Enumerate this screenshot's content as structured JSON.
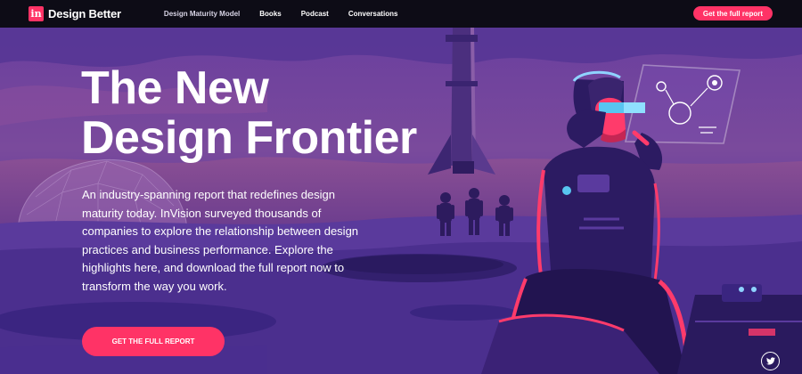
{
  "nav": {
    "logo_mark": "in",
    "logo_text": "Design Better",
    "links": [
      "Design Maturity Model",
      "Books",
      "Podcast",
      "Conversations"
    ],
    "cta_label": "Get the full report"
  },
  "hero": {
    "title_line1": "The New",
    "title_line2": "Design Frontier",
    "body": "An industry-spanning report that redefines design maturity today. InVision surveyed thousands of companies to explore the relationship between design practices and business performance. Explore the highlights here, and download the full report now to transform the way you work.",
    "cta_label": "GET THE FULL REPORT"
  },
  "social": {
    "icon": "twitter-icon"
  },
  "colors": {
    "accent": "#ff3366",
    "nav_bg": "#0d0c16",
    "sky": "#5b3a9e",
    "ground": "#3b2478"
  }
}
